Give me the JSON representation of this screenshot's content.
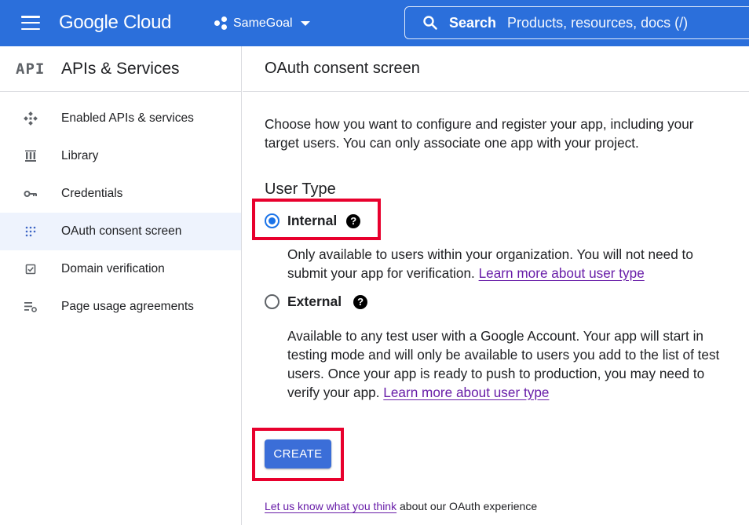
{
  "header": {
    "logo_text": "Google Cloud",
    "project_name": "SameGoal",
    "search_label": "Search",
    "search_placeholder": "Products, resources, docs (/)",
    "brand_color": "#2b6fdb"
  },
  "sidebar": {
    "badge": "API",
    "title": "APIs & Services",
    "items": [
      {
        "label": "Enabled APIs & services",
        "icon": "diamond-nodes-icon"
      },
      {
        "label": "Library",
        "icon": "library-icon"
      },
      {
        "label": "Credentials",
        "icon": "key-icon"
      },
      {
        "label": "OAuth consent screen",
        "icon": "dots-grid-icon",
        "active": true
      },
      {
        "label": "Domain verification",
        "icon": "checkbox-icon"
      },
      {
        "label": "Page usage agreements",
        "icon": "list-settings-icon"
      }
    ]
  },
  "main": {
    "title": "OAuth consent screen",
    "intro_line1": "Choose how you want to configure and register your app, including your",
    "intro_line2": "target users. You can only associate one app with your project.",
    "user_type_heading": "User Type",
    "internal": {
      "label": "Internal",
      "selected": true,
      "desc_line1": "Only available to users within your organization. You will not need to",
      "desc_line2_prefix": "submit your app for verification.",
      "link": "Learn more about user type"
    },
    "external": {
      "label": "External",
      "selected": false,
      "desc_line1": "Available to any test user with a Google Account. Your app will start in",
      "desc_line2": "testing mode and will only be available to users you add to the list of test",
      "desc_line3": "users. Once your app is ready to push to production, you may need to",
      "desc_line4_prefix": "verify your app.",
      "link": "Learn more about user type"
    },
    "create_button": "CREATE",
    "feedback_link": "Let us know what you think",
    "feedback_suffix": "about our OAuth experience",
    "help_glyph": "?"
  },
  "highlight_color": "#e8002d"
}
